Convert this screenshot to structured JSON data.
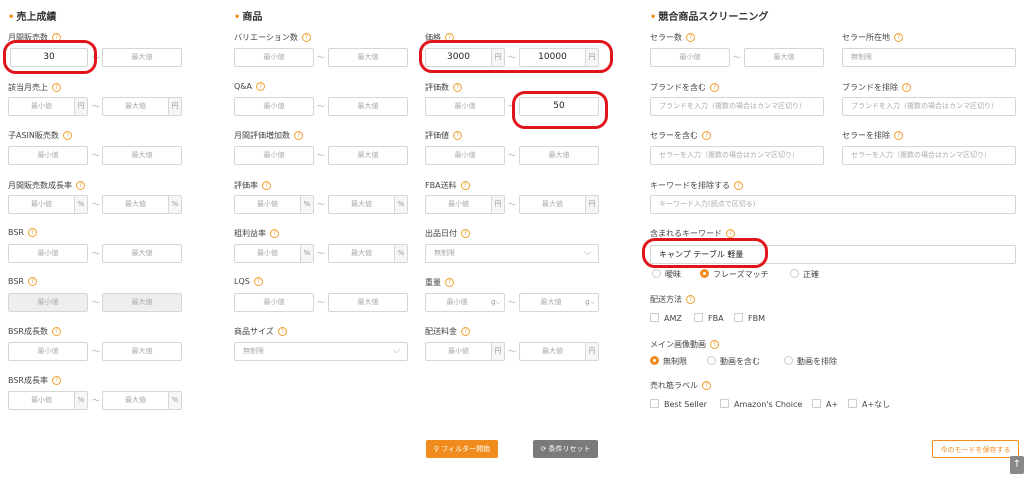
{
  "sections": {
    "sales": "売上成績",
    "product": "商品",
    "competitor": "競合商品スクリーニング"
  },
  "ph": {
    "min": "最小値",
    "max": "最大値",
    "unlimited": "無制限"
  },
  "units": {
    "yen": "円",
    "pct": "%",
    "g": "g"
  },
  "tilde": "～",
  "sales": {
    "monthly_sales": {
      "label": "月間販売数",
      "min_value": "30"
    },
    "monthly_revenue": {
      "label": "該当月売上"
    },
    "child_asin": {
      "label": "子ASIN販売数"
    },
    "sales_growth": {
      "label": "月間販売数成長率"
    },
    "bsr": {
      "label": "BSR"
    },
    "bsr2": {
      "label": "BSR"
    },
    "bsr_count": {
      "label": "BSR成長数"
    },
    "bsr_rate": {
      "label": "BSR成長率"
    }
  },
  "product": {
    "variations": {
      "label": "バリエーション数"
    },
    "qa": {
      "label": "Q&A"
    },
    "monthly_reviews": {
      "label": "月間評価増加数"
    },
    "rating_rate": {
      "label": "評価率"
    },
    "gross_margin": {
      "label": "粗利益率"
    },
    "lqs": {
      "label": "LQS"
    },
    "size": {
      "label": "商品サイズ"
    },
    "price": {
      "label": "価格",
      "min_value": "3000",
      "max_value": "10000"
    },
    "review_count": {
      "label": "評価数",
      "max_value": "50"
    },
    "rating": {
      "label": "評価値"
    },
    "fba_fee": {
      "label": "FBA送料"
    },
    "listing_date": {
      "label": "出品日付"
    },
    "weight": {
      "label": "重量"
    },
    "shipping": {
      "label": "配送料金"
    }
  },
  "competitor": {
    "seller_count": {
      "label": "セラー数"
    },
    "seller_location": {
      "label": "セラー所在地"
    },
    "include_brand": {
      "label": "ブランドを含む",
      "placeholder": "ブランドを入力（複数の場合はカンマ区切り）"
    },
    "exclude_brand": {
      "label": "ブランドを排除",
      "placeholder": "ブランドを入力（複数の場合はカンマ区切り）"
    },
    "include_seller": {
      "label": "セラーを含む",
      "placeholder": "セラーを入力（複数の場合はカンマ区切り）"
    },
    "exclude_seller": {
      "label": "セラーを排除",
      "placeholder": "セラーを入力（複数の場合はカンマ区切り）"
    },
    "exclude_keyword": {
      "label": "キーワードを排除する",
      "placeholder": "キーワード入力(読点で区切る)"
    },
    "include_keyword": {
      "label": "含まれるキーワード",
      "value": "キャンプ テーブル 軽量"
    },
    "match_modes": [
      "曖昧",
      "フレーズマッチ",
      "正確"
    ],
    "shipping_method": {
      "label": "配送方法",
      "options": [
        "AMZ",
        "FBA",
        "FBM"
      ]
    },
    "main_video": {
      "label": "メイン画像動画",
      "options": [
        "無制限",
        "動画を含む",
        "動画を排除"
      ]
    },
    "best_label": {
      "label": "売れ筋ラベル",
      "options": [
        "Best Seller",
        "Amazon's Choice",
        "A+",
        "A+なし"
      ]
    }
  },
  "buttons": {
    "filter": "フィルター開始",
    "reset": "条件リセット",
    "save": "今のモードを保存する"
  },
  "colors": {
    "accent": "#f08c1e",
    "highlight": "#e0141a",
    "reset": "#7a7a7a"
  }
}
